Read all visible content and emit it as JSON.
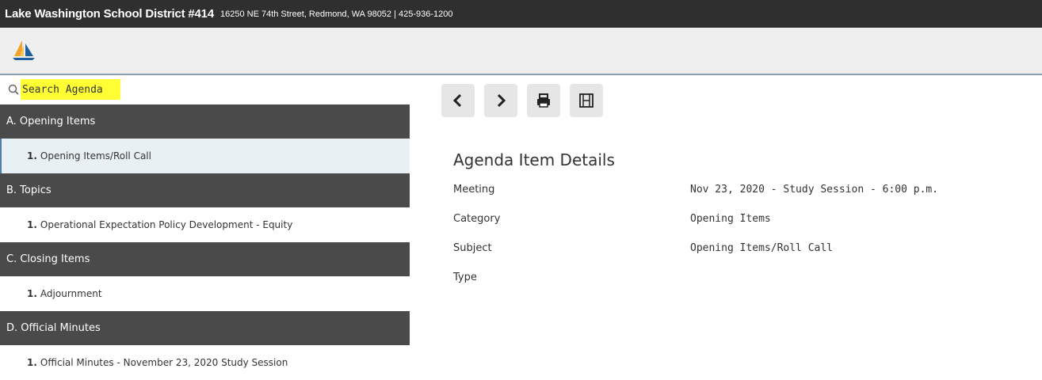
{
  "header": {
    "org_name": "Lake Washington School District #414",
    "address": "16250 NE 74th Street, Redmond, WA 98052 | 425-936-1200"
  },
  "logo": {
    "icon": "sailboat-logo-icon"
  },
  "search": {
    "placeholder": "Search Agenda",
    "value": ""
  },
  "agenda": {
    "sections": [
      {
        "label": "A. Opening Items",
        "items": [
          {
            "num": "1.",
            "label": "Opening Items/Roll Call",
            "selected": true
          }
        ]
      },
      {
        "label": "B. Topics",
        "items": [
          {
            "num": "1.",
            "label": "Operational Expectation Policy Development - Equity"
          }
        ]
      },
      {
        "label": "C. Closing Items",
        "items": [
          {
            "num": "1.",
            "label": "Adjournment"
          }
        ]
      },
      {
        "label": "D. Official Minutes",
        "items": [
          {
            "num": "1.",
            "label": "Official Minutes - November 23, 2020 Study Session"
          }
        ]
      }
    ]
  },
  "toolbar": {
    "buttons": [
      "chevron-left-icon",
      "chevron-right-icon",
      "print-icon",
      "film-icon"
    ]
  },
  "details": {
    "title": "Agenda Item Details",
    "rows": [
      {
        "label": "Meeting",
        "value": "Nov 23, 2020 - Study Session - 6:00 p.m."
      },
      {
        "label": "Category",
        "value": "Opening Items"
      },
      {
        "label": "Subject",
        "value": "Opening Items/Roll Call"
      },
      {
        "label": "Type",
        "value": ""
      }
    ]
  },
  "colors": {
    "topbar": "#2f2f2f",
    "section_header": "#4a4a4a",
    "search_highlight": "#ffff33",
    "selected_item": "#e9f0f4"
  }
}
